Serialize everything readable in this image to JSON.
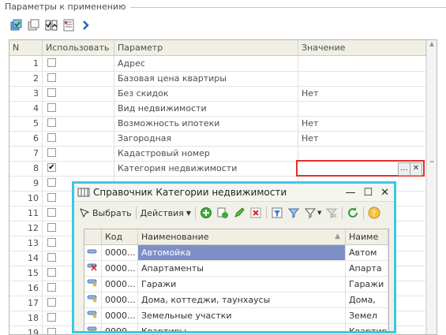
{
  "group_title": "Параметры к применению",
  "grid": {
    "headers": {
      "n": "N",
      "use": "Использовать",
      "param": "Параметр",
      "value": "Значение"
    },
    "rows": [
      {
        "n": "1",
        "checked": false,
        "param": "Адрес",
        "value": ""
      },
      {
        "n": "2",
        "checked": false,
        "param": "Базовая цена квартиры",
        "value": ""
      },
      {
        "n": "3",
        "checked": false,
        "param": "Без скидок",
        "value": "Нет"
      },
      {
        "n": "4",
        "checked": false,
        "param": "Вид недвижимости",
        "value": ""
      },
      {
        "n": "5",
        "checked": false,
        "param": "Возможность ипотеки",
        "value": "Нет"
      },
      {
        "n": "6",
        "checked": false,
        "param": "Загородная",
        "value": "Нет"
      },
      {
        "n": "7",
        "checked": false,
        "param": "Кадастровый номер",
        "value": ""
      },
      {
        "n": "8",
        "checked": true,
        "param": "Категория недвижимости",
        "value": ""
      },
      {
        "n": "9",
        "checked": false,
        "param": "",
        "value": ""
      },
      {
        "n": "10",
        "checked": false,
        "param": "",
        "value": ""
      },
      {
        "n": "11",
        "checked": false,
        "param": "",
        "value": ""
      },
      {
        "n": "12",
        "checked": false,
        "param": "",
        "value": ""
      },
      {
        "n": "13",
        "checked": false,
        "param": "",
        "value": ""
      },
      {
        "n": "14",
        "checked": false,
        "param": "",
        "value": ""
      },
      {
        "n": "15",
        "checked": false,
        "param": "",
        "value": ""
      },
      {
        "n": "16",
        "checked": false,
        "param": "",
        "value": ""
      },
      {
        "n": "17",
        "checked": false,
        "param": "",
        "value": ""
      },
      {
        "n": "18",
        "checked": false,
        "param": "",
        "value": ""
      },
      {
        "n": "19",
        "checked": false,
        "param": "",
        "value": ""
      }
    ],
    "edit_buttons": {
      "select": "...",
      "clear": "✕"
    }
  },
  "dialog": {
    "title": "Справочник Категории недвижимости",
    "controls": {
      "minimize": "—",
      "maximize": "☐",
      "close": "✕"
    },
    "toolbar": {
      "select_label": "Выбрать",
      "actions_label": "Действия"
    },
    "headers": {
      "code": "Код",
      "name": "Наименование",
      "name2": "Наиме"
    },
    "rows": [
      {
        "code": "0000...",
        "name": "Автомойка",
        "name2": "Автом",
        "selected": true
      },
      {
        "code": "0000...",
        "name": "Апартаменты",
        "name2": "Апарта"
      },
      {
        "code": "0000...",
        "name": "Гаражи",
        "name2": "Гаражи"
      },
      {
        "code": "0000...",
        "name": "Дома, коттеджи, таунхаусы",
        "name2": "Дома,"
      },
      {
        "code": "0000...",
        "name": "Земельные участки",
        "name2": "Земел"
      },
      {
        "code": "0000...",
        "name": "Квартиры",
        "name2": "Квартиры"
      }
    ]
  },
  "colors": {
    "highlight_red": "#e0302a",
    "dialog_border": "#3bc8e7",
    "selection": "#7d8fc7"
  }
}
